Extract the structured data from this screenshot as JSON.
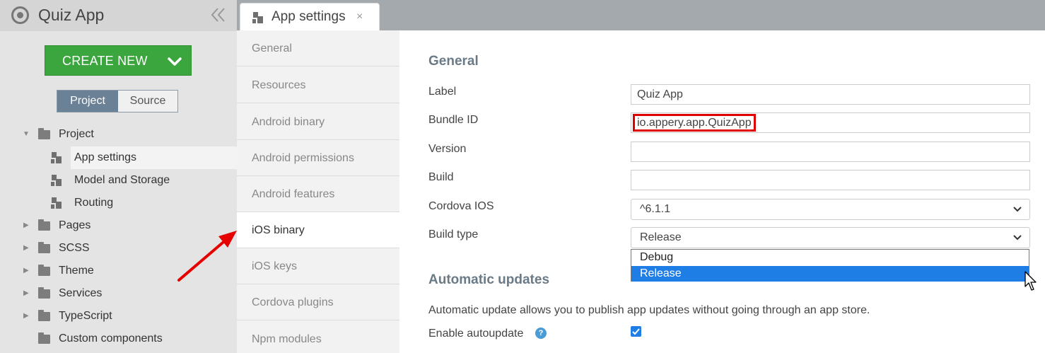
{
  "app": {
    "title": "Quiz App"
  },
  "sidebar": {
    "create_new_label": "CREATE NEW",
    "toggle": {
      "project": "Project",
      "source": "Source"
    },
    "tree": {
      "project": "Project",
      "app_settings": "App settings",
      "model_storage": "Model and Storage",
      "routing": "Routing",
      "pages": "Pages",
      "scss": "SCSS",
      "theme": "Theme",
      "services": "Services",
      "typescript": "TypeScript",
      "custom_components": "Custom components"
    }
  },
  "tabs": {
    "active": {
      "label": "App settings",
      "close": "×"
    }
  },
  "settings_nav": {
    "general": "General",
    "resources": "Resources",
    "android_binary": "Android binary",
    "android_permissions": "Android permissions",
    "android_features": "Android features",
    "ios_binary": "iOS binary",
    "ios_keys": "iOS keys",
    "cordova_plugins": "Cordova plugins",
    "npm_modules": "Npm modules"
  },
  "form": {
    "general_title": "General",
    "label": {
      "label": "Label",
      "value": "Quiz App"
    },
    "bundle_id": {
      "label": "Bundle ID",
      "value": "io.appery.app.QuizApp"
    },
    "version": {
      "label": "Version",
      "value": ""
    },
    "build": {
      "label": "Build",
      "value": ""
    },
    "cordova_ios": {
      "label": "Cordova IOS",
      "value": "^6.1.1"
    },
    "build_type": {
      "label": "Build type",
      "value": "Release",
      "options": {
        "debug": "Debug",
        "release": "Release"
      }
    },
    "auto_updates_title": "Automatic updates",
    "auto_updates_desc": "Automatic update allows you to publish app updates without going through an app store.",
    "enable_autoupdate": {
      "label": "Enable autoupdate",
      "help": "?",
      "checked": true
    }
  },
  "colors": {
    "create_button": "#3aa63d",
    "project_toggle": "#6b8196",
    "highlight_box": "#e00000",
    "dropdown_selected": "#1e7ee6",
    "annotation_arrow": "#e60000"
  }
}
